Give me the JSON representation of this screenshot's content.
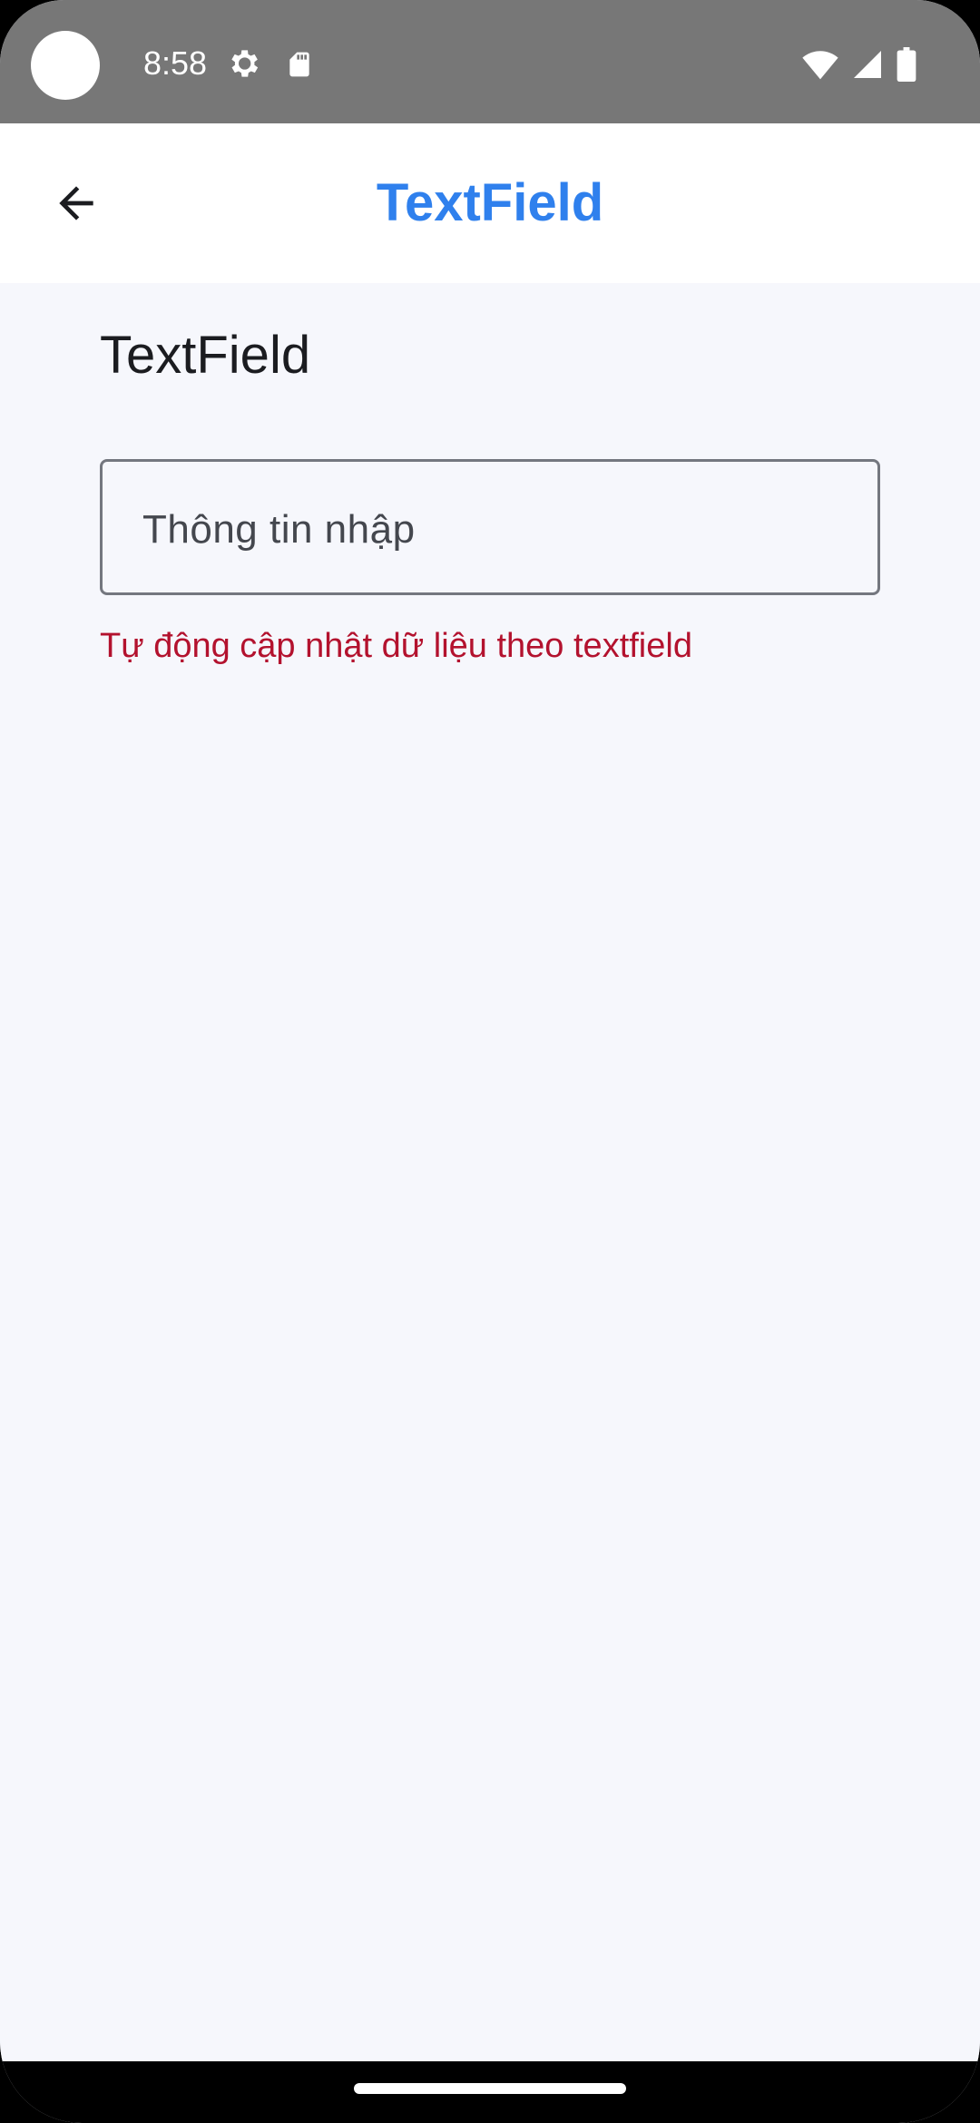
{
  "status_bar": {
    "time": "8:58",
    "icons": [
      "camera-cutout",
      "settings-gear-icon",
      "sd-card-icon",
      "wifi-icon",
      "cell-signal-icon",
      "battery-icon"
    ]
  },
  "app_bar": {
    "back_icon": "arrow-back-icon",
    "title": "TextField",
    "title_color": "#2f80ed"
  },
  "content": {
    "section_title": "TextField",
    "text_field": {
      "value": "",
      "placeholder": "Thông tin nhập"
    },
    "helper_text": "Tự động cập nhật dữ liệu theo textfield",
    "helper_color": "#b3122e"
  },
  "colors": {
    "status_bar": "#777777",
    "app_bar": "#ffffff",
    "background": "#f6f7fc",
    "field_border": "#74777f"
  }
}
